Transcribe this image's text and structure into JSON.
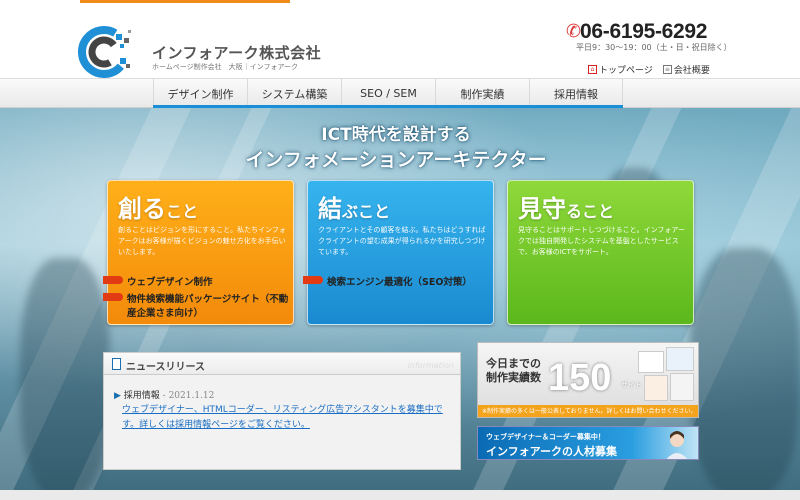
{
  "header": {
    "company_name": "インフォアーク株式会社",
    "company_sub": "ホームページ制作会社　大阪｜インフォアーク",
    "phone": "06-6195-6292",
    "hours": "平日9：30〜19：00（土・日・祝日除く）",
    "links": [
      {
        "label": "トップページ",
        "icon": "home-icon"
      },
      {
        "label": "会社概要",
        "icon": "document-icon"
      }
    ]
  },
  "nav": {
    "items": [
      "デザイン制作",
      "システム構築",
      "SEO / SEM",
      "制作実績",
      "採用情報"
    ]
  },
  "hero": {
    "line1": "ICT時代を設計する",
    "line2": "インフォメーションアーキテクター"
  },
  "cards": [
    {
      "title_main": "創る",
      "title_suffix": "こと",
      "body": "創ることはビジョンを形にすること。私たちインフォアークはお客様が描くビジョンの魅せ方化をお手伝いいたします。",
      "links": [
        "ウェブデザイン制作",
        "物件検索機能パッケージサイト（不動産企業さま向け）"
      ]
    },
    {
      "title_main": "結",
      "title_suffix": "ぶこと",
      "body": "クライアントとその顧客を結ぶ。私たちはどうすればクライアントの望む成果が得られるかを研究しつづけています。",
      "links": [
        "検索エンジン最適化（SEO対策）"
      ]
    },
    {
      "title_main": "見守",
      "title_suffix": "ること",
      "body": "見守ることはサポートしつづけること。インフォアークでは独自開発したシステムを基盤としたサービスで、お客様のICTをサポート。",
      "links": []
    }
  ],
  "news": {
    "title": "ニュースリリース",
    "watermark": "information",
    "item_title": "採用情報",
    "item_date": " - 2021.1.12",
    "item_body": "ウェブデザイナー、HTMLコーダー、リスティング広告アシスタントを募集中です。詳しくは採用情報ページをご覧ください。"
  },
  "banner_works": {
    "label1": "今日までの",
    "label2": "制作実績数",
    "count": "150",
    "unit": "サイト",
    "footer": "※制作実績の多くは一般公表しておりません。詳しくはお問い合わせください。"
  },
  "banner_recruit": {
    "small": "ウェブデザイナー＆コーダー募集中！",
    "big": "インフォアークの人材募集"
  },
  "colors": {
    "accent_blue": "#1a8ed6",
    "orange": "#f38a0a",
    "blue": "#1a8ad0",
    "green": "#5bb81c",
    "link_blue": "#1a6ec4"
  }
}
